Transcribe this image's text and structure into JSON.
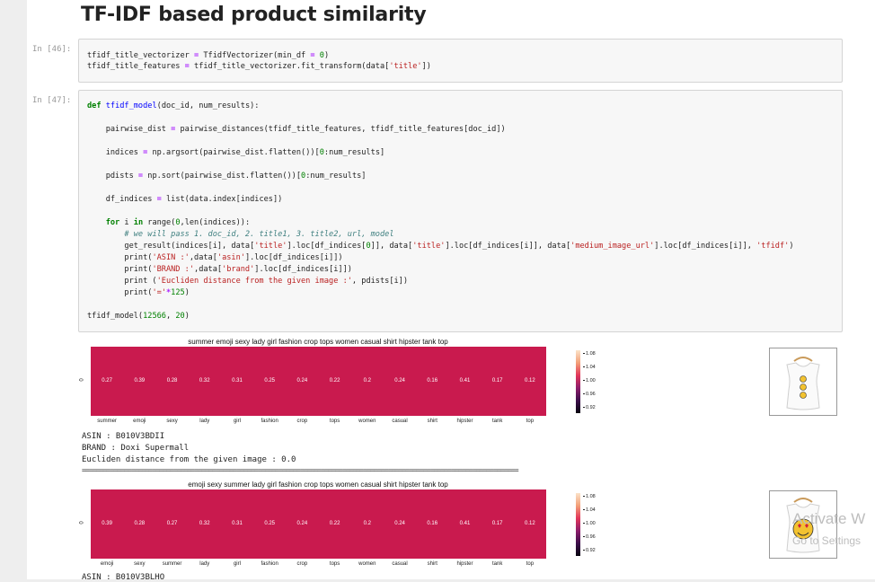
{
  "notebook": {
    "heading": "TF-IDF based product similarity",
    "cells": [
      {
        "prompt": "In [46]:"
      },
      {
        "prompt": "In [47]:"
      }
    ]
  },
  "outputs": [
    {
      "title": "summer emoji sexy lady girl fashion crop tops women casual shirt hipster tank top",
      "row_label": "0",
      "values": [
        "0.27",
        "0.39",
        "0.28",
        "0.32",
        "0.31",
        "0.25",
        "0.24",
        "0.22",
        "0.2",
        "0.24",
        "0.16",
        "0.41",
        "0.17",
        "0.12"
      ],
      "words": [
        "summer",
        "emoji",
        "sexy",
        "lady",
        "girl",
        "fashion",
        "crop",
        "tops",
        "women",
        "casual",
        "shirt",
        "hipster",
        "tank",
        "top"
      ],
      "colorbar_ticks": [
        "1.08",
        "1.04",
        "1.00",
        "0.96",
        "0.92"
      ],
      "asin": "ASIN : B010V3BDII",
      "brand": "BRAND : Doxi Supermall",
      "distance": "Eucliden distance from the given image : 0.0",
      "thumbnail": "emoji-tank-top-thumbnail"
    },
    {
      "title": "emoji sexy summer lady girl fashion crop tops women casual shirt hipster tank top",
      "row_label": "0",
      "values": [
        "0.39",
        "0.28",
        "0.27",
        "0.32",
        "0.31",
        "0.25",
        "0.24",
        "0.22",
        "0.2",
        "0.24",
        "0.16",
        "0.41",
        "0.17",
        "0.12"
      ],
      "words": [
        "emoji",
        "sexy",
        "summer",
        "lady",
        "girl",
        "fashion",
        "crop",
        "tops",
        "women",
        "casual",
        "shirt",
        "hipster",
        "tank",
        "top"
      ],
      "colorbar_ticks": [
        "1.08",
        "1.04",
        "1.00",
        "0.96",
        "0.92"
      ],
      "asin_partial": "ASIN : B010V3BLHO",
      "thumbnail": "emoji-tank-top-thumbnail"
    }
  ],
  "separator": "============================================================================================================================",
  "watermark": {
    "line1": "Activate W",
    "line2": "Go to Settings"
  },
  "colors": {
    "heatmap": "#c91a4e",
    "code_bg": "#f7f7f7",
    "keyword": "#008000",
    "string": "#ba2121",
    "comment": "#408080"
  }
}
